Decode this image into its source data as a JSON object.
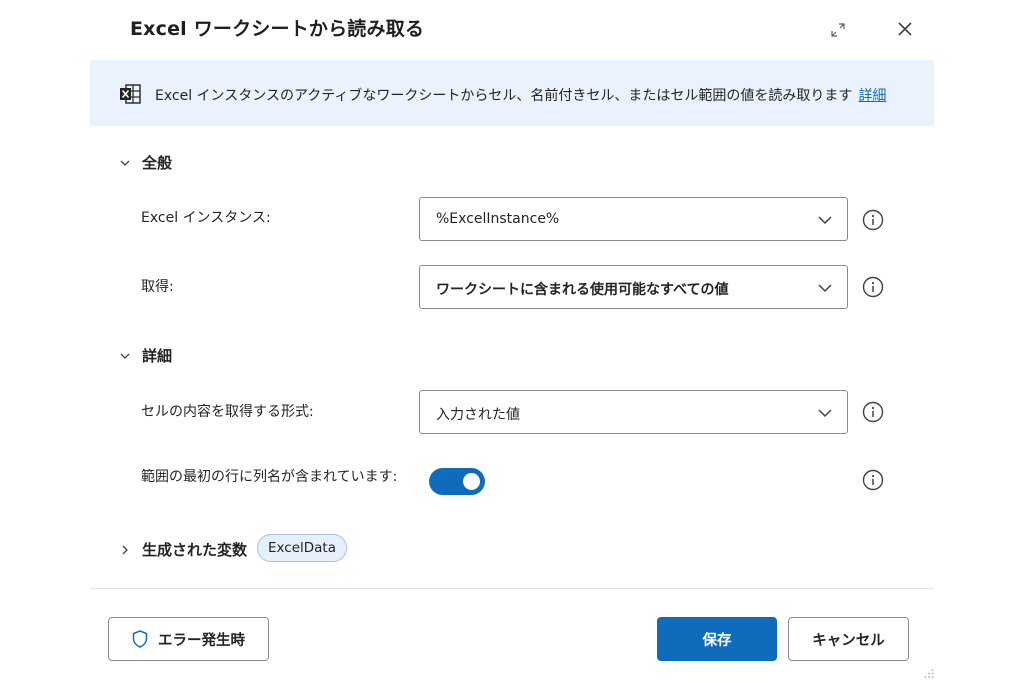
{
  "dialog": {
    "title": "Excel ワークシートから読み取る"
  },
  "banner": {
    "icon": "excel-icon",
    "text": "Excel インスタンスのアクティブなワークシートからセル、名前付きセル、またはセル範囲の値を読み取ります",
    "link": "詳細"
  },
  "general": {
    "header": "全般",
    "fields": [
      {
        "label": "Excel インスタンス:",
        "value": "%ExcelInstance%"
      },
      {
        "label": "取得:",
        "value": "ワークシートに含まれる使用可能なすべての値"
      }
    ]
  },
  "detail": {
    "header": "詳細",
    "format_label": "セルの内容を取得する形式:",
    "format_value": "入力された値",
    "header_row_label": "範囲の最初の行に列名が含まれています:",
    "header_row_enabled": true
  },
  "variables": {
    "header": "生成された変数",
    "chips": [
      "ExcelData"
    ]
  },
  "footer": {
    "on_error": "エラー発生時",
    "save": "保存",
    "cancel": "キャンセル"
  },
  "colors": {
    "accent": "#0f6cbd",
    "banner_bg": "#eaf2fd",
    "chip_bg": "#e6f0fb"
  }
}
